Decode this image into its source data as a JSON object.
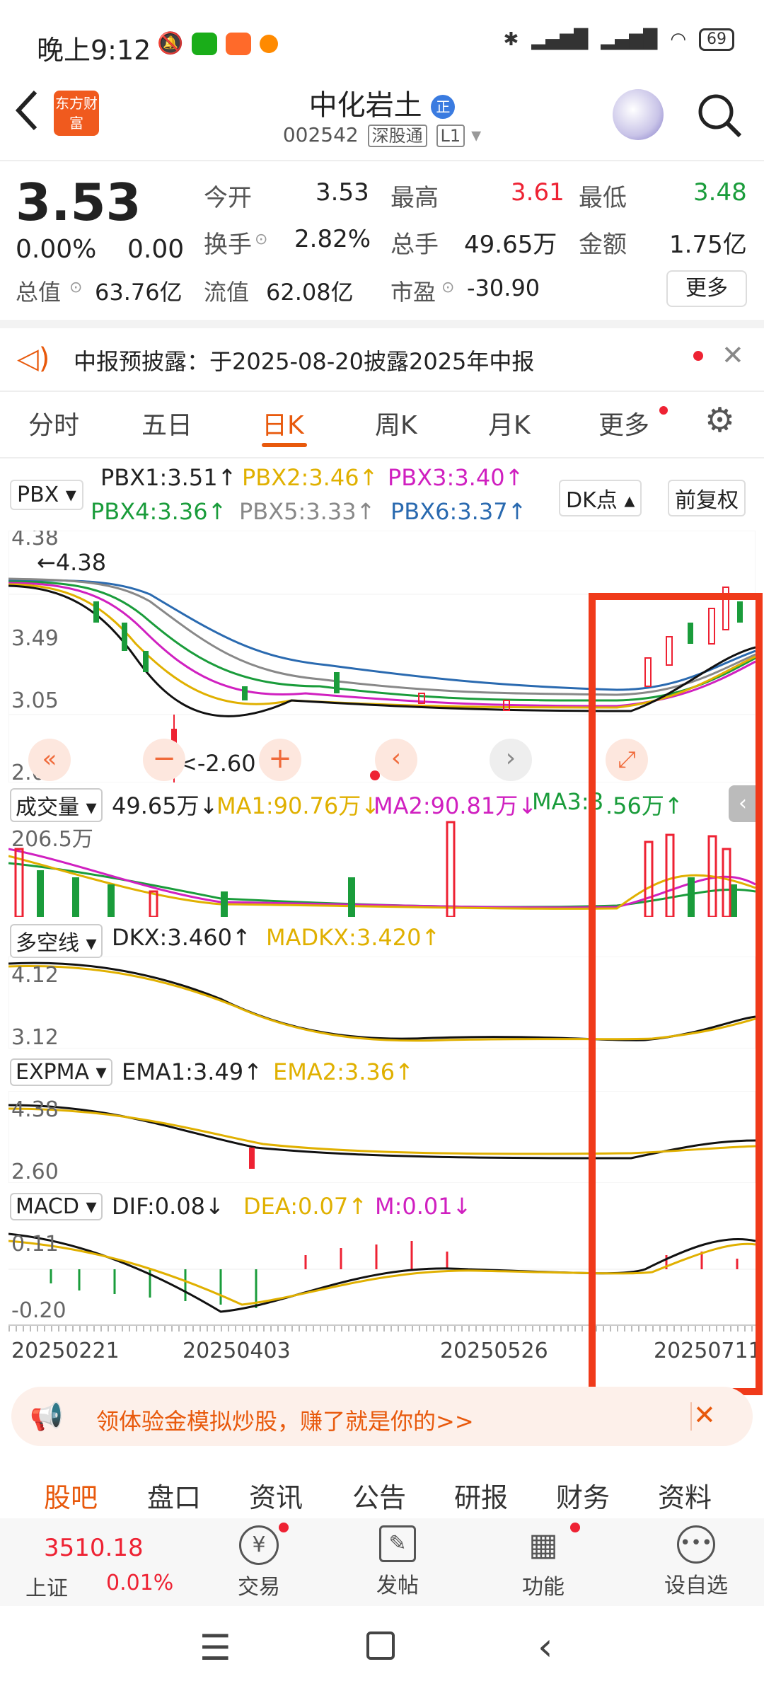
{
  "status": {
    "time": "晚上9:12",
    "battery": "69"
  },
  "header": {
    "logo": "东方财富",
    "name": "中化岩土",
    "badge": "正",
    "code": "002542",
    "tag1": "深股通",
    "tag2": "L1"
  },
  "quote": {
    "price": "3.53",
    "pct": "0.00%",
    "change": "0.00",
    "open_label": "今开",
    "open": "3.53",
    "high_label": "最高",
    "high": "3.61",
    "low_label": "最低",
    "low": "3.48",
    "turn_label": "换手",
    "turn": "2.82%",
    "vol_label": "总手",
    "vol": "49.65万",
    "amt_label": "金额",
    "amt": "1.75亿",
    "mcap_label": "总值",
    "mcap": "63.76亿",
    "float_label": "流值",
    "float": "62.08亿",
    "pe_label": "市盈",
    "pe": "-30.90",
    "more": "更多"
  },
  "notice": {
    "text": "中报预披露：于2025-08-20披露2025年中报"
  },
  "tabs": [
    "分时",
    "五日",
    "日K",
    "周K",
    "月K",
    "更多"
  ],
  "pbx": {
    "label": "PBX",
    "p1": "PBX1:3.51↑",
    "p2": "PBX2:3.46↑",
    "p3": "PBX3:3.40↑",
    "p4": "PBX4:3.36↑",
    "p5": "PBX5:3.33↑",
    "p6": "PBX6:3.37↑",
    "dk": "DK点",
    "fq": "前复权"
  },
  "kline": {
    "y1": "4.38",
    "y2": "3.49",
    "y3": "3.05",
    "y4": "2.60",
    "maxlbl": "4.38",
    "minlbl": "2.60"
  },
  "volume": {
    "label": "成交量",
    "v": "49.65万↓",
    "ma1": "MA1:90.76万↓",
    "ma2": "MA2:90.81万↓",
    "ma3": "MA3:8",
    "ma3b": ".56万↑",
    "ymax": "206.5万"
  },
  "dkx": {
    "label": "多空线",
    "v": "DKX:3.460↑",
    "mad": "MADKX:3.420↑",
    "y1": "4.12",
    "y2": "3.12"
  },
  "expma": {
    "label": "EXPMA",
    "e1": "EMA1:3.49↑",
    "e2": "EMA2:3.36↑",
    "y1": "4.38",
    "y2": "2.60"
  },
  "macd": {
    "label": "MACD",
    "dif": "DIF:0.08↓",
    "dea": "DEA:0.07↑",
    "m": "M:0.01↓",
    "y1": "0.11",
    "y2": "-0.20"
  },
  "dates": [
    "20250221",
    "20250403",
    "20250526",
    "20250711"
  ],
  "banner": {
    "text": "领体验金模拟炒股，赚了就是你的>>"
  },
  "bottomtabs": [
    "股吧",
    "盘口",
    "资讯",
    "公告",
    "研报",
    "财务",
    "资料"
  ],
  "footer": {
    "index_val": "3510.18",
    "index_name": "上证",
    "index_pct": "0.01%",
    "trade": "交易",
    "post": "发帖",
    "func": "功能",
    "fav": "设自选"
  },
  "colors": {
    "accent": "#e8590c",
    "up": "#e23",
    "down": "#1a9c3b",
    "highlight": "#f03a1a"
  }
}
